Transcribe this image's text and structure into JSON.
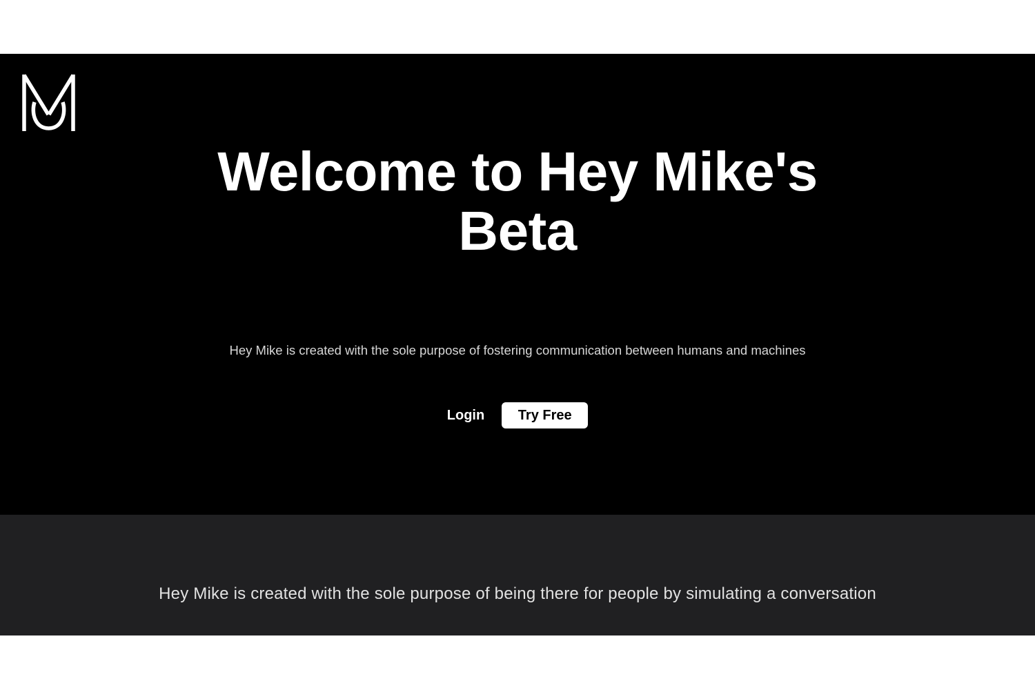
{
  "brand": {
    "logo_icon": "hey-mike-monogram-logo",
    "accent_color": "#ffffff",
    "hero_background": "#000000",
    "section_background": "#202022"
  },
  "hero": {
    "title_line1": "Welcome to Hey Mike's",
    "title_line2": "Beta",
    "subtitle": "Hey Mike is created with the sole purpose of fostering communication between humans and machines",
    "login_label": "Login",
    "try_free_label": "Try Free"
  },
  "about": {
    "text": "Hey Mike is created with the sole purpose of being there for people by simulating a conversation"
  }
}
